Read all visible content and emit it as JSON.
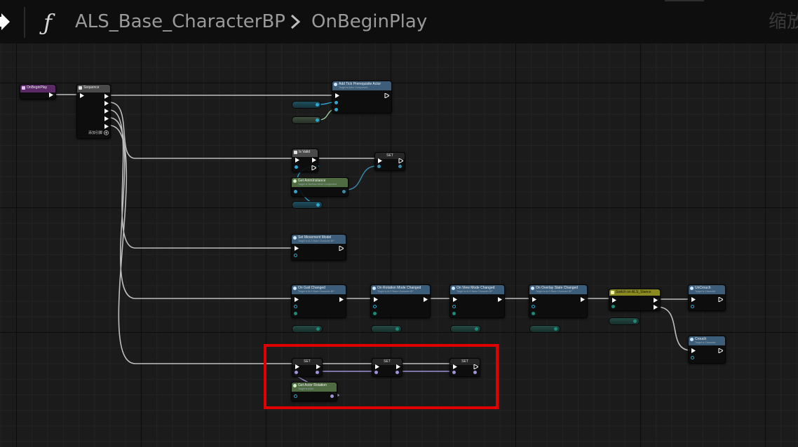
{
  "header": {
    "function_icon": "function-f-icon",
    "breadcrumb": [
      "ALS_Base_CharacterBP",
      "OnBeginPlay"
    ],
    "zoom_label": "缩放"
  },
  "nodes": {
    "on_begin_play": "OnBeginPlay",
    "sequence": "Sequence",
    "sequence_add_pin": "添加引脚",
    "add_tick_prereq": "Add Tick Prerequisite Actor",
    "add_tick_prereq_sub": "Target is Actor Component",
    "is_valid": "Is Valid",
    "set_1": "SET",
    "get_anim_instance": "Get AnimInstance",
    "get_anim_instance_sub": "Target is Skeletal Mesh Component",
    "set_movement_model": "Set Movement Model",
    "set_movement_model_sub": "Target is ALS Base Character BP",
    "on_gait_changed": "On Gait Changed",
    "on_gait_changed_sub": "Target is ALS Base Character BP",
    "on_rotation_mode_changed": "On Rotation Mode Changed",
    "on_rotation_mode_changed_sub": "Target is ALS Base Character BP",
    "on_view_mode_changed": "On View Mode Changed",
    "on_view_mode_changed_sub": "Target is ALS Base Character BP",
    "on_overlay_state_changed": "On Overlay State Changed",
    "on_overlay_state_changed_sub": "Target is ALS Base Character BP",
    "switch_on_stance": "Switch on ALS_Stance",
    "un_crouch": "UnCrouch",
    "un_crouch_sub": "Target is Character",
    "crouch": "Crouch",
    "crouch_sub": "Target is Character",
    "set_a": "SET",
    "set_b": "SET",
    "set_c": "SET",
    "get_actor_rotation": "Get Actor Rotation",
    "get_actor_rotation_sub": "Target is Actor"
  },
  "colors": {
    "highlight_box": "#e00000",
    "event_header": "#5a2a66",
    "function_header": "#3d5e7a",
    "pure_header": "#4e6b42",
    "switch_header": "#8a8a20",
    "exec_wire": "#d8d8d8",
    "object_pin": "#2ea7d0",
    "anim_pin": "#5aa0b0"
  }
}
